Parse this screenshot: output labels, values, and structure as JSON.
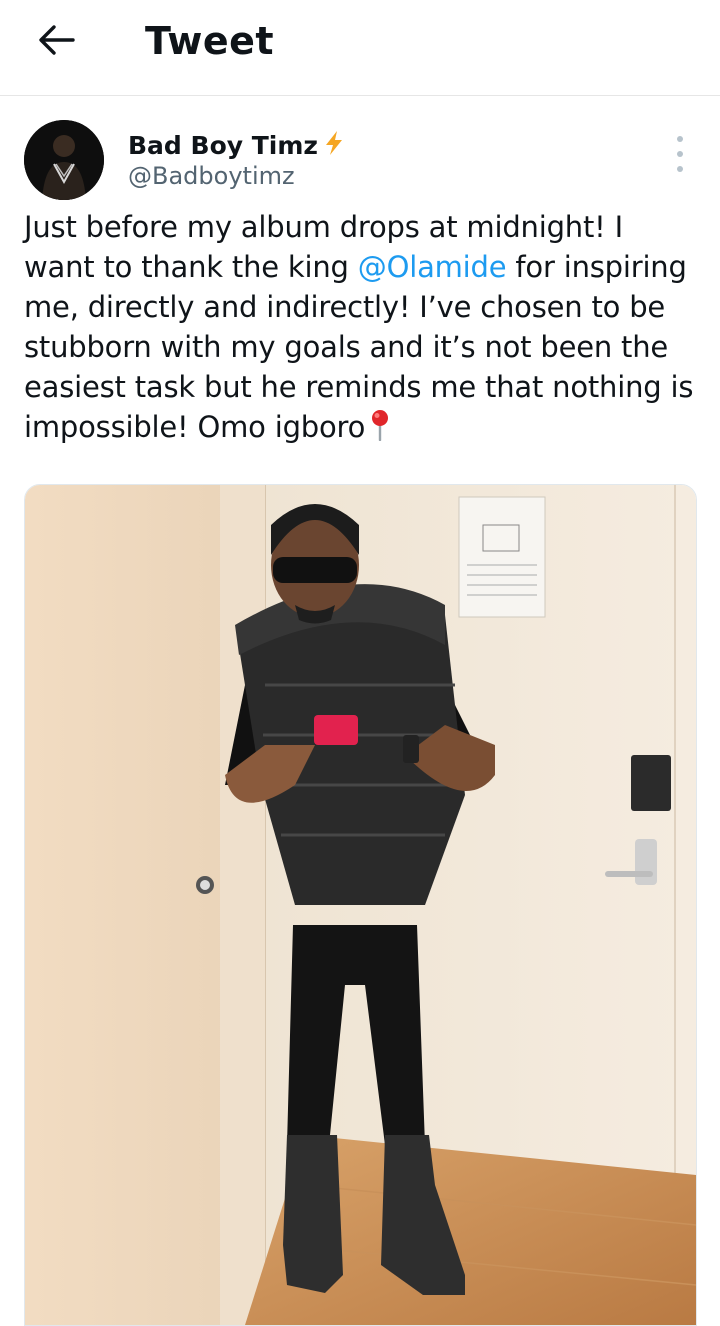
{
  "header": {
    "title": "Tweet",
    "back_icon": "arrow-left-icon"
  },
  "tweet": {
    "author": {
      "display_name": "Bad Boy Timz",
      "handle": "@Badboytimz",
      "badge_icon": "lightning-bolt-icon"
    },
    "text_part1": "Just before my album drops at midnight! I want to thank the king ",
    "mention": "@Olamide",
    "text_part2": " for inspiring me, directly and indirectly! I’ve chosen to be stubborn with my goals and it’s not been the easiest task but he reminds me that nothing is impossible! Omo igboro",
    "pin_icon": "round-pushpin-icon",
    "more_icon": "more-vertical-icon"
  },
  "colors": {
    "accent": "#1d9bf0",
    "bolt": "#f5a623",
    "text": "#0f1419",
    "secondary": "#536471"
  }
}
